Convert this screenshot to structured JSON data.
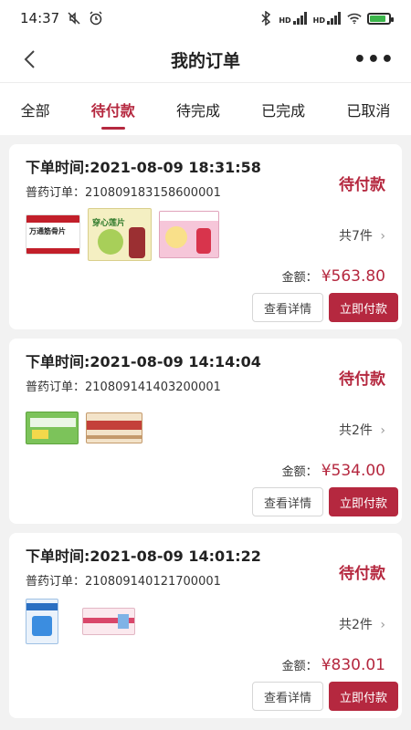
{
  "statusbar": {
    "time": "14:37",
    "net1": "HD",
    "net2": "HD",
    "battery_pct": 0.75
  },
  "header": {
    "title": "我的订单"
  },
  "tabs": [
    {
      "label": "全部",
      "active": false
    },
    {
      "label": "待付款",
      "active": true
    },
    {
      "label": "待完成",
      "active": false
    },
    {
      "label": "已完成",
      "active": false
    },
    {
      "label": "已取消",
      "active": false
    }
  ],
  "orders": [
    {
      "time": "下单时间:2021-08-09 18:31:58",
      "order_no": "普药订单：210809183158600001",
      "status": "待付款",
      "count": "共7件",
      "amount_label": "金额：",
      "amount": "¥563.80",
      "detail_label": "查看详情",
      "pay_label": "立即付款"
    },
    {
      "time": "下单时间:2021-08-09 14:14:04",
      "order_no": "普药订单：210809141403200001",
      "status": "待付款",
      "count": "共2件",
      "amount_label": "金额：",
      "amount": "¥534.00",
      "detail_label": "查看详情",
      "pay_label": "立即付款"
    },
    {
      "time": "下单时间:2021-08-09 14:01:22",
      "order_no": "普药订单：210809140121700001",
      "status": "待付款",
      "count": "共2件",
      "amount_label": "金额：",
      "amount": "¥830.01",
      "detail_label": "查看详情",
      "pay_label": "立即付款"
    }
  ],
  "products": {
    "p1": "万通筋骨片",
    "p2": "穿心莲片"
  },
  "colors": {
    "accent": "#b5283f"
  }
}
